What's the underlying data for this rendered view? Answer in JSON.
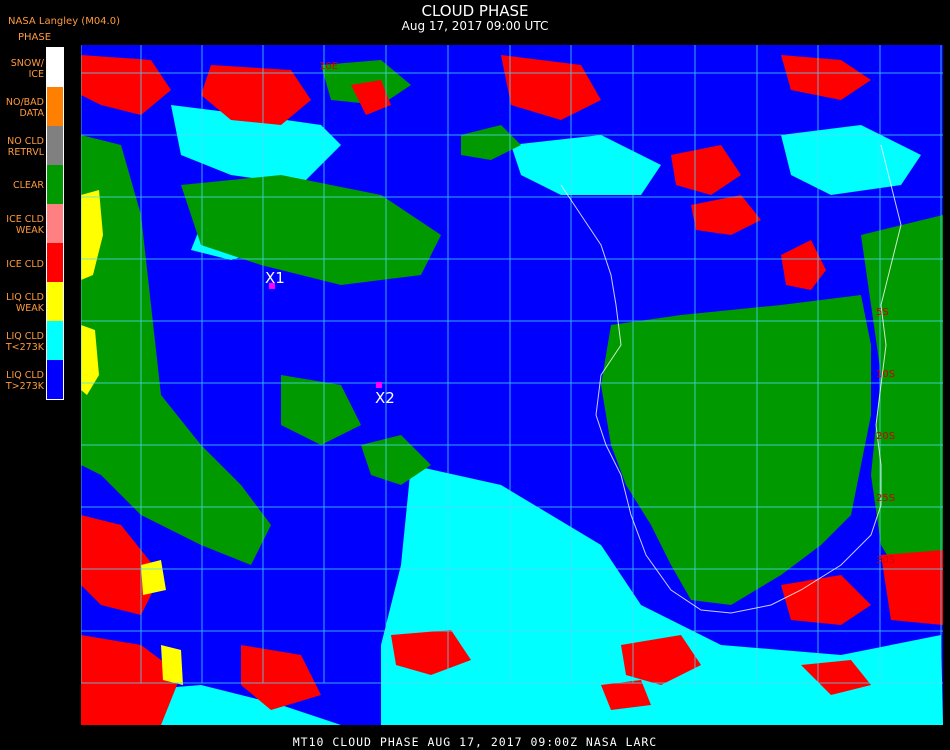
{
  "header": {
    "title": "CLOUD PHASE",
    "datetime": "Aug 17, 2017 09:00 UTC",
    "producer": "NASA Langley (M04.0)"
  },
  "legend": {
    "title": "PHASE",
    "items": [
      {
        "label": "SNOW/\nICE",
        "color": "#ffffff"
      },
      {
        "label": "NO/BAD\nDATA",
        "color": "#ff8000"
      },
      {
        "label": "NO CLD\nRETRVL",
        "color": "#808080"
      },
      {
        "label": "CLEAR",
        "color": "#009900"
      },
      {
        "label": "ICE CLD\nWEAK",
        "color": "#ff8080"
      },
      {
        "label": "ICE CLD",
        "color": "#ff0000"
      },
      {
        "label": "LIQ CLD\nWEAK",
        "color": "#ffff00"
      },
      {
        "label": "LIQ CLD\nT<273K",
        "color": "#00ffff"
      },
      {
        "label": "LIQ CLD\nT>273K",
        "color": "#0000ff"
      }
    ]
  },
  "map": {
    "markers": [
      {
        "label": "X1",
        "color": "#ff00ff"
      },
      {
        "label": "X2",
        "color": "#ff00ff"
      }
    ],
    "grid_labels": [
      "10E",
      "5S",
      "10S",
      "20S",
      "25S",
      "30S"
    ]
  },
  "footer": {
    "text": "MT10  CLOUD PHASE   AUG 17, 2017 09:00Z   NASA LARC"
  }
}
